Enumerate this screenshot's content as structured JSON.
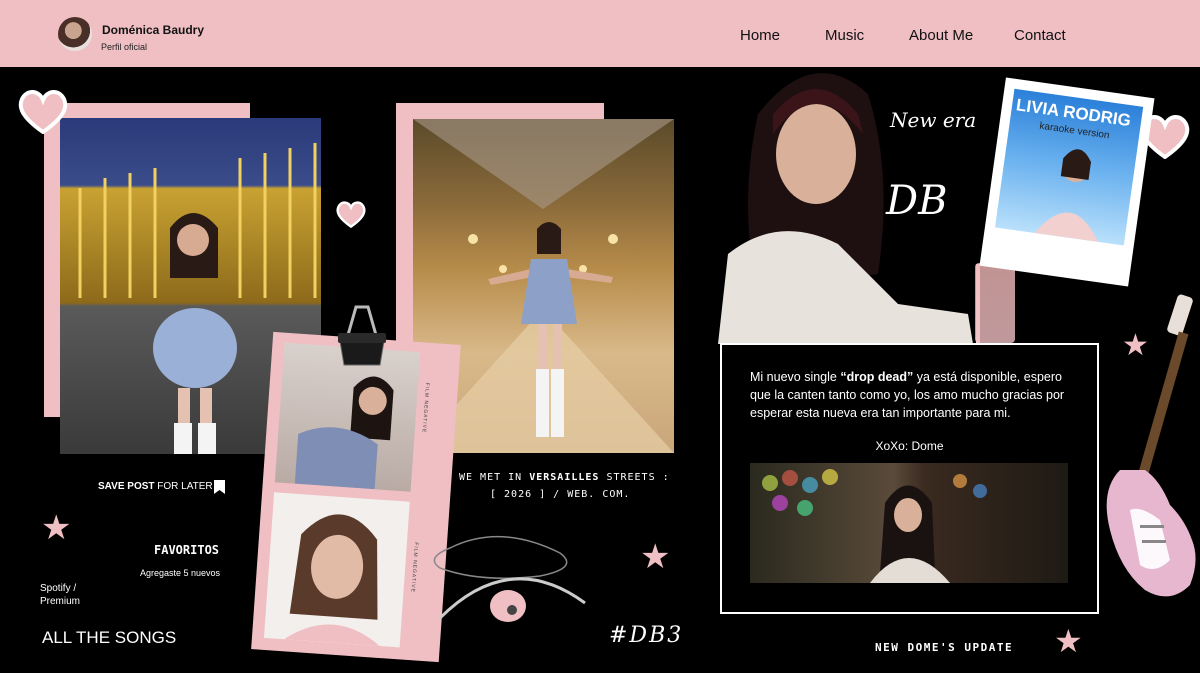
{
  "header": {
    "profile_name": "Doménica Baudry",
    "profile_subtitle": "Perfil oficial",
    "nav": [
      "Home",
      "Music",
      "About Me",
      "Contact"
    ]
  },
  "collage": {
    "save_post_bold": "SAVE POST",
    "save_post_rest": " FOR LATER",
    "met_line1_pre": "WE MET IN ",
    "met_line1_bold": "VERSAILLES",
    "met_line1_post": " STREETS :",
    "met_line2": "[ 2026 ] / WEB. COM.",
    "favoritos_title": "FAVORITOS",
    "favoritos_sub": "Agregaste 5 nuevos",
    "spotify_line1": "Spotify /",
    "spotify_line2": "Premium",
    "all_songs": "ALL THE SONGS",
    "hashtag": "#DB3",
    "new_era": "New era",
    "db_logo": "DB",
    "polaroid_caption_top": "LIVIA RODRIG",
    "polaroid_caption_sub": "karaoke version",
    "film_edge": "FILM NEGATIVE"
  },
  "update": {
    "text_pre": "Mi nuevo single ",
    "text_bold": "“drop dead”",
    "text_post": " ya está disponible, espero que la canten tanto como yo, los amo mucho gracias por esperar esta nueva era tan importante para mi.",
    "signoff": "XoXo: Dome",
    "footer": "NEW DOME'S UPDATE"
  },
  "colors": {
    "accent_pink": "#efbfc3",
    "background": "#000000",
    "text": "#ffffff"
  },
  "icons": [
    "heart-icon",
    "star-icon",
    "bookmark-icon",
    "binder-clip-icon",
    "headphones-icon",
    "guitar-icon"
  ]
}
